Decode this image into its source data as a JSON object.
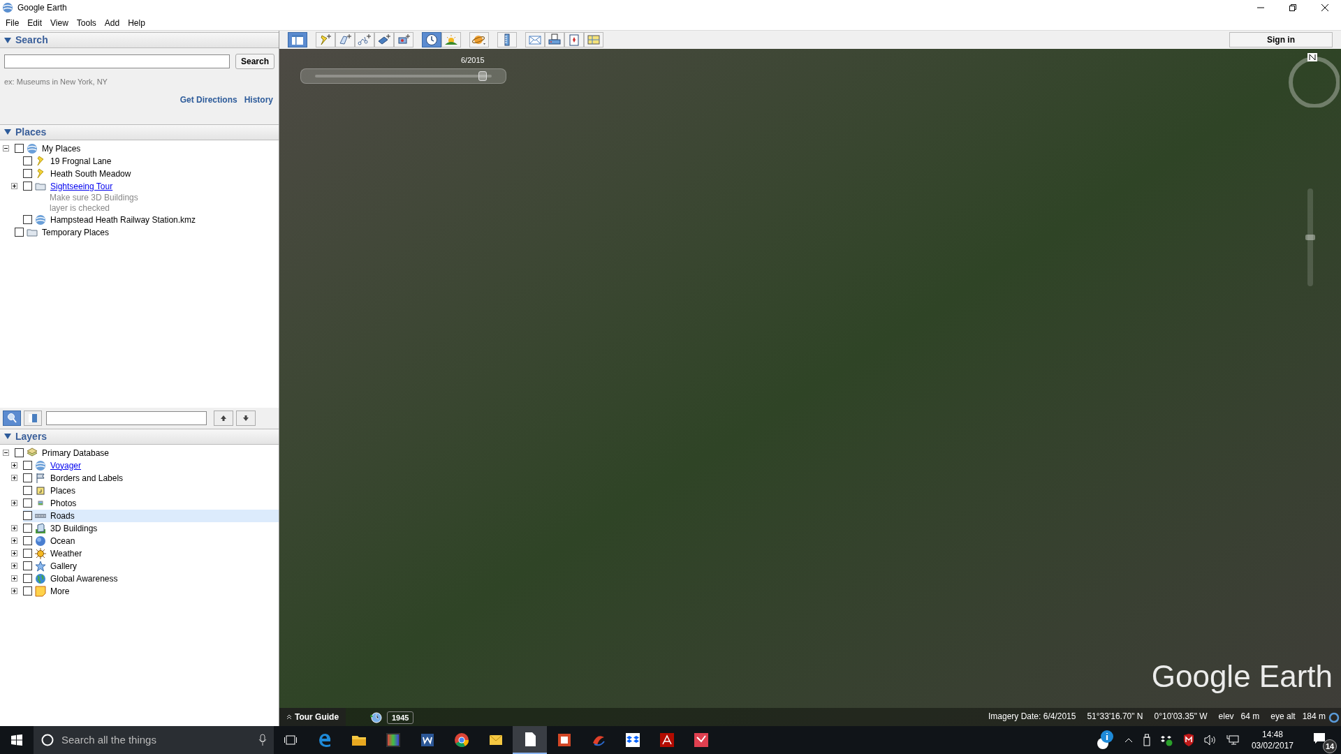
{
  "window": {
    "title": "Google Earth"
  },
  "menu": [
    "File",
    "Edit",
    "View",
    "Tools",
    "Add",
    "Help"
  ],
  "search": {
    "header": "Search",
    "button": "Search",
    "hint": "ex: Museums in New York, NY",
    "links": [
      "Get Directions",
      "History"
    ]
  },
  "places": {
    "header": "Places",
    "items": [
      {
        "name": "My Places",
        "kind": "globe",
        "checked": false,
        "expanded": true,
        "children": [
          {
            "name": "19 Frognal Lane",
            "kind": "pin",
            "checked": false
          },
          {
            "name": "Heath South Meadow",
            "kind": "pin",
            "checked": false
          },
          {
            "name": "Sightseeing Tour",
            "kind": "folder",
            "checked": false,
            "expanded": false,
            "link": true,
            "description": [
              "Make sure 3D Buildings",
              "layer is checked"
            ]
          },
          {
            "name": "Hampstead Heath Railway Station.kmz",
            "kind": "globe",
            "checked": false
          }
        ]
      },
      {
        "name": "Temporary Places",
        "kind": "folder",
        "checked": false
      }
    ]
  },
  "panel_tools": [
    {
      "kind": "search",
      "selected": true
    },
    {
      "kind": "panel",
      "selected": false
    }
  ],
  "layers": {
    "header": "Layers",
    "items": [
      {
        "name": "Primary Database",
        "kind": "database",
        "checked": false,
        "expanded": true,
        "selected": false,
        "children": [
          {
            "name": "Voyager",
            "kind": "globe",
            "checked": false,
            "expanded": false,
            "link": true,
            "selected": false
          },
          {
            "name": "Borders and Labels",
            "kind": "flag",
            "checked": false,
            "expanded": false,
            "selected": false
          },
          {
            "name": "Places",
            "kind": "square",
            "checked": false,
            "selected": false
          },
          {
            "name": "Photos",
            "kind": "photo",
            "checked": false,
            "expanded": false,
            "selected": false
          },
          {
            "name": "Roads",
            "kind": "road",
            "checked": false,
            "selected": true
          },
          {
            "name": "3D Buildings",
            "kind": "building",
            "checked": false,
            "expanded": false,
            "selected": false
          },
          {
            "name": "Ocean",
            "kind": "ocean",
            "checked": false,
            "expanded": false,
            "selected": false
          },
          {
            "name": "Weather",
            "kind": "sun",
            "checked": false,
            "expanded": false,
            "selected": false
          },
          {
            "name": "Gallery",
            "kind": "star",
            "checked": false,
            "expanded": false,
            "selected": false
          },
          {
            "name": "Global Awareness",
            "kind": "world",
            "checked": false,
            "expanded": false,
            "selected": false
          },
          {
            "name": "More",
            "kind": "note",
            "checked": false,
            "expanded": false,
            "selected": false
          }
        ]
      }
    ]
  },
  "toolbar": [
    [
      {
        "kind": "sidebar",
        "selected": true
      }
    ],
    [
      {
        "kind": "placemark",
        "selected": false
      },
      {
        "kind": "polygon",
        "selected": false
      },
      {
        "kind": "path",
        "selected": false
      },
      {
        "kind": "overlay",
        "selected": false
      },
      {
        "kind": "tour",
        "selected": false
      }
    ],
    [
      {
        "kind": "history",
        "selected": true
      },
      {
        "kind": "sunlight",
        "selected": false
      }
    ],
    [
      {
        "kind": "planet",
        "selected": false
      }
    ],
    [
      {
        "kind": "ruler",
        "selected": false
      }
    ],
    [
      {
        "kind": "email",
        "selected": false
      },
      {
        "kind": "print",
        "selected": false
      },
      {
        "kind": "maps",
        "selected": false
      },
      {
        "kind": "image",
        "selected": false
      }
    ]
  ],
  "sign_in": "Sign in",
  "map": {
    "time_slider": {
      "label": "6/2015",
      "level": 0.95
    },
    "zoom_slider": {
      "level": 0.5
    },
    "logo": "Google Earth",
    "tour_guide": "Tour Guide",
    "historical_year": "1945",
    "status": [
      "Imagery Date: 6/4/2015",
      "51°33'16.70\" N",
      "0°10'03.35\" W",
      "elev",
      "64 m",
      "eye alt",
      "184 m"
    ]
  },
  "taskbar": {
    "search_placeholder": "Search all the things",
    "apps": [
      {
        "kind": "edge",
        "active": false
      },
      {
        "kind": "explorer",
        "active": false
      },
      {
        "kind": "photos",
        "active": false
      },
      {
        "kind": "word",
        "active": false
      },
      {
        "kind": "chrome",
        "active": false
      },
      {
        "kind": "mail",
        "active": false
      },
      {
        "kind": "document",
        "active": true
      },
      {
        "kind": "office",
        "active": false
      },
      {
        "kind": "swirl",
        "active": false
      },
      {
        "kind": "dropbox",
        "active": false
      },
      {
        "kind": "pdf",
        "active": false
      },
      {
        "kind": "zip",
        "active": false
      }
    ],
    "time": "14:48",
    "date": "03/02/2017",
    "notifications": "14"
  }
}
